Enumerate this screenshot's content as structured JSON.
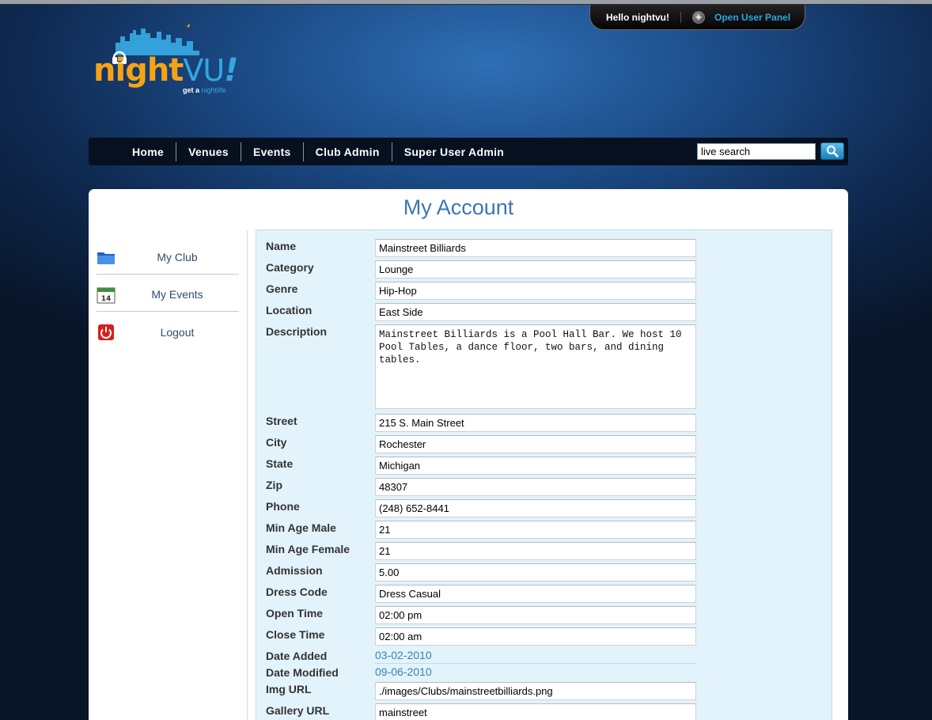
{
  "user_panel": {
    "greeting": "Hello nightvu!",
    "open_label": "Open User Panel"
  },
  "logo": {
    "word_night": "night",
    "word_vu": "VU",
    "mark": "!",
    "tagline_prefix": "get a ",
    "tagline_accent": "nightlife"
  },
  "nav": {
    "items": [
      "Home",
      "Venues",
      "Events",
      "Club Admin",
      "Super User Admin"
    ],
    "search_value": "live search"
  },
  "page": {
    "title": "My Account"
  },
  "sidebar": {
    "items": [
      {
        "label": "My Club",
        "icon": "folder-icon"
      },
      {
        "label": "My Events",
        "icon": "calendar-icon",
        "icon_text": "14"
      },
      {
        "label": "Logout",
        "icon": "power-icon"
      }
    ]
  },
  "form": {
    "name": {
      "label": "Name",
      "value": "Mainstreet Billiards"
    },
    "category": {
      "label": "Category",
      "value": "Lounge"
    },
    "genre": {
      "label": "Genre",
      "value": "Hip-Hop"
    },
    "location": {
      "label": "Location",
      "value": "East Side"
    },
    "description": {
      "label": "Description",
      "value": "Mainstreet Billiards is a Pool Hall Bar. We host 10 Pool Tables, a dance floor, two bars, and dining tables."
    },
    "street": {
      "label": "Street",
      "value": "215 S. Main Street"
    },
    "city": {
      "label": "City",
      "value": "Rochester"
    },
    "state": {
      "label": "State",
      "value": "Michigan"
    },
    "zip": {
      "label": "Zip",
      "value": "48307"
    },
    "phone": {
      "label": "Phone",
      "value": "(248) 652-8441"
    },
    "min_age_male": {
      "label": "Min Age Male",
      "value": "21"
    },
    "min_age_female": {
      "label": "Min Age Female",
      "value": "21"
    },
    "admission": {
      "label": "Admission",
      "value": "5.00"
    },
    "dress_code": {
      "label": "Dress Code",
      "value": "Dress Casual"
    },
    "open_time": {
      "label": "Open Time",
      "value": "02:00 pm"
    },
    "close_time": {
      "label": "Close Time",
      "value": "02:00 am"
    },
    "date_added": {
      "label": "Date Added",
      "value": "03-02-2010"
    },
    "date_modified": {
      "label": "Date Modified",
      "value": "09-06-2010"
    },
    "img_url": {
      "label": "Img URL",
      "value": "./images/Clubs/mainstreetbilliards.png"
    },
    "gallery_url": {
      "label": "Gallery URL",
      "value": "mainstreet"
    }
  },
  "colors": {
    "brand_orange": "#f5a316",
    "brand_blue": "#35a7e0",
    "title_blue": "#3b76b3",
    "form_bg": "#e3f3fb",
    "link_blue": "#2ea6e0"
  }
}
